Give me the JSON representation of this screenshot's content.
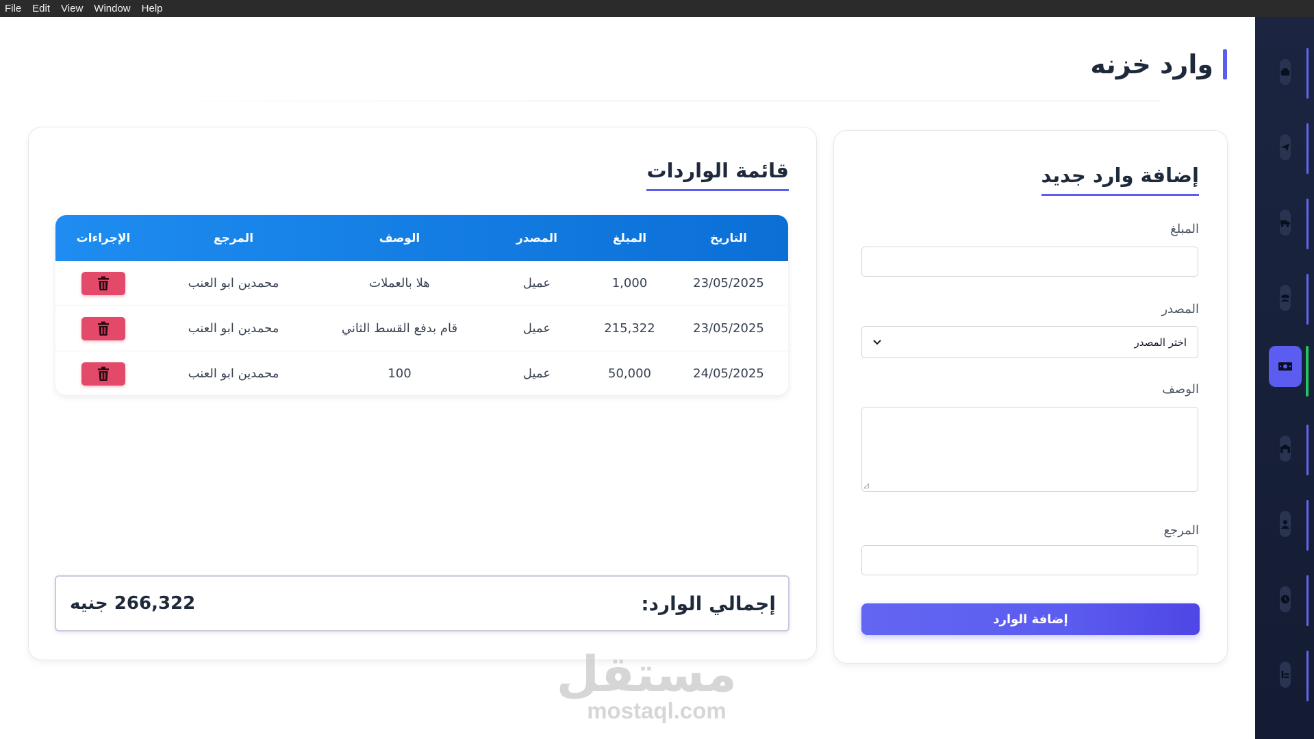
{
  "menubar": {
    "items": [
      "File",
      "Edit",
      "View",
      "Window",
      "Help"
    ]
  },
  "page": {
    "title": "وارد خزنه"
  },
  "sidebar": {
    "items": [
      {
        "icon": "cash-register-icon",
        "active": false
      },
      {
        "icon": "paper-plane-icon",
        "active": false
      },
      {
        "icon": "truck-icon",
        "active": false
      },
      {
        "icon": "users-icon",
        "active": false
      },
      {
        "icon": "money-bill-icon",
        "active": true
      },
      {
        "icon": "warehouse-icon",
        "active": false
      },
      {
        "icon": "user-icon",
        "active": false
      },
      {
        "icon": "clock-icon",
        "active": false
      },
      {
        "icon": "report-icon",
        "active": false
      }
    ],
    "accent": "#5b5cf0",
    "active_indicator": "#22c55e"
  },
  "form": {
    "title": "إضافة وارد جديد",
    "amount_label": "المبلغ",
    "amount_value": "",
    "source_label": "المصدر",
    "source_selected": "اختر المصدر",
    "description_label": "الوصف",
    "description_value": "",
    "reference_label": "المرجع",
    "reference_value": "",
    "submit_label": "إضافة الوارد"
  },
  "list": {
    "title": "قائمة الواردات",
    "columns": {
      "date": "التاريخ",
      "amount": "المبلغ",
      "source": "المصدر",
      "description": "الوصف",
      "reference": "المرجع",
      "actions": "الإجراءات"
    },
    "rows": [
      {
        "date": "23/05/2025",
        "amount": "1,000",
        "source": "عميل",
        "description": "هلا بالعملات",
        "reference": "محمدين ابو العنب"
      },
      {
        "date": "23/05/2025",
        "amount": "215,322",
        "source": "عميل",
        "description": "قام بدفع القسط الثاني",
        "reference": "محمدين ابو العنب"
      },
      {
        "date": "24/05/2025",
        "amount": "50,000",
        "source": "عميل",
        "description": "100",
        "reference": "محمدين ابو العنب"
      }
    ],
    "total_label": "إجمالي الوارد:",
    "total_value": "266,322 جنيه"
  },
  "watermark": {
    "arabic": "مستقل",
    "latin": "mostaql.com"
  },
  "colors": {
    "header_gradient_start": "#1e8cf0",
    "header_gradient_end": "#0b6fd6",
    "delete": "#e34a6a"
  }
}
